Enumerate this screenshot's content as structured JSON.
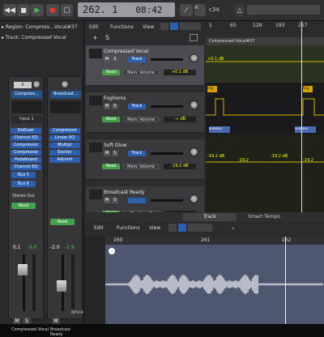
{
  "transport": {
    "position": "262. 1",
    "time": "08:42",
    "key": "A",
    "tempo_sig": "4/4",
    "count": "c34"
  },
  "inspector": {
    "region_label": "Region: Compress...Vocal#37",
    "track_label": "Track: Compressed Vocal",
    "strip1": {
      "setting": "Compress...",
      "input": "Input 1",
      "plugins": [
        "DeEsser",
        "Channel EQ",
        "Compressor",
        "Compressor",
        "Pedalboard",
        "Channel EQ"
      ],
      "sends": [
        "Bus 5",
        "Bus 6"
      ],
      "output": "Stereo Out",
      "mode": "Read",
      "vol": "0.1",
      "peak": "-6.0",
      "name": "Compressed Vocal",
      "value": "0"
    },
    "strip2": {
      "setting": "Broadcast...",
      "plugins": [
        "Compressor",
        "Linear EQ",
        "Multipr",
        "Exciter",
        "AdLimit"
      ],
      "mode": "Read",
      "vol": "-2.0",
      "peak": "-2.9",
      "name": "Broadcast Ready",
      "bnce": "Bnce",
      "value": "0"
    }
  },
  "tracks_toolbar": {
    "edit": "Edit",
    "functions": "Functions",
    "view": "View"
  },
  "tracks": [
    {
      "name": "Compressed Vocal",
      "mode": "Read",
      "param": "Main: Volume",
      "value": "+0.1 dB",
      "track": "Track"
    },
    {
      "name": "Foghorns",
      "mode": "Read",
      "param": "Main: Volume",
      "value": "-∞ dB",
      "track": "Track"
    },
    {
      "name": "Soft Glow",
      "mode": "Read",
      "param": "Main: Volume",
      "value": "-19.2 dB",
      "track": "Track"
    },
    {
      "name": "Broadcast Ready",
      "mode": "Read",
      "param": "Display off",
      "value": "",
      "track": ""
    }
  ],
  "ruler": [
    "1",
    "65",
    "129",
    "193",
    "257"
  ],
  "arrange": {
    "region_name": "Compressed Vocal#37",
    "db_1": "+0.1 dB",
    "region_labels": [
      "Fog",
      "Fog",
      "summer",
      "summer"
    ],
    "db_2": "-19.2 dB",
    "db_3": "-19.2",
    "db_4": "-19.2 dB",
    "db_5": "-19.2"
  },
  "editor": {
    "tabs": [
      "Track",
      "Smart Tempo"
    ],
    "edit": "Edit",
    "functions": "Functions",
    "view": "View",
    "ruler": [
      "260",
      "261",
      "262"
    ]
  },
  "colors": {
    "accent": "#2d7fe0",
    "green": "#46c04a",
    "yellow": "#d6b400",
    "waveform": "#ffffff"
  }
}
